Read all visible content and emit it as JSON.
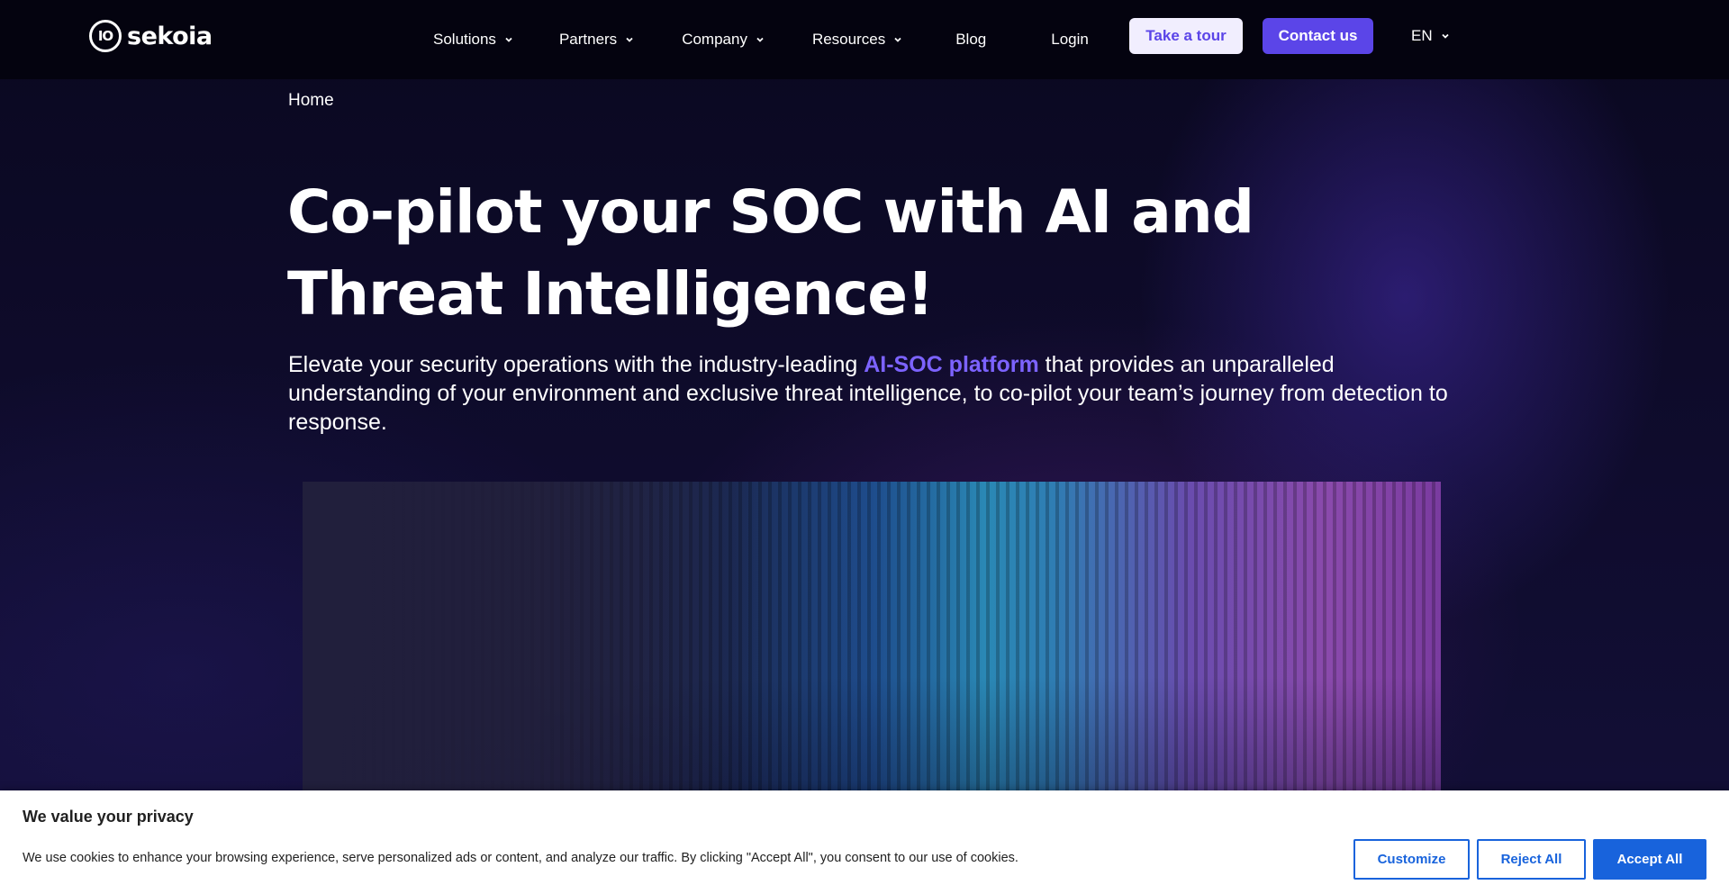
{
  "header": {
    "logo_text": "sekoia",
    "logo_mark": "IO",
    "nav": [
      {
        "label": "Solutions",
        "has_dropdown": true
      },
      {
        "label": "Partners",
        "has_dropdown": true
      },
      {
        "label": "Company",
        "has_dropdown": true
      },
      {
        "label": "Resources",
        "has_dropdown": true
      },
      {
        "label": "Blog",
        "has_dropdown": false
      },
      {
        "label": "Login",
        "has_dropdown": false
      }
    ],
    "tour_button": "Take a tour",
    "contact_button": "Contact us",
    "language": "EN"
  },
  "breadcrumb": "Home",
  "hero": {
    "title": "Co-pilot your SOC with AI and Threat Intelligence!",
    "lead_before": "Elevate your security operations with the industry-leading ",
    "lead_link": "AI-SOC platform",
    "lead_after": " that provides an unparalleled understanding of your environment and exclusive threat intelligence, to co-pilot your team’s journey from detection to response."
  },
  "cookie_banner": {
    "title": "We value your privacy",
    "text": "We use cookies to enhance your browsing experience, serve personalized ads or content, and analyze our traffic. By clicking \"Accept All\", you consent to our use of cookies.",
    "customize": "Customize",
    "reject": "Reject All",
    "accept": "Accept All"
  },
  "colors": {
    "accent": "#5b45e8",
    "link": "#7c63ff",
    "cookie_button": "#1863dc"
  }
}
